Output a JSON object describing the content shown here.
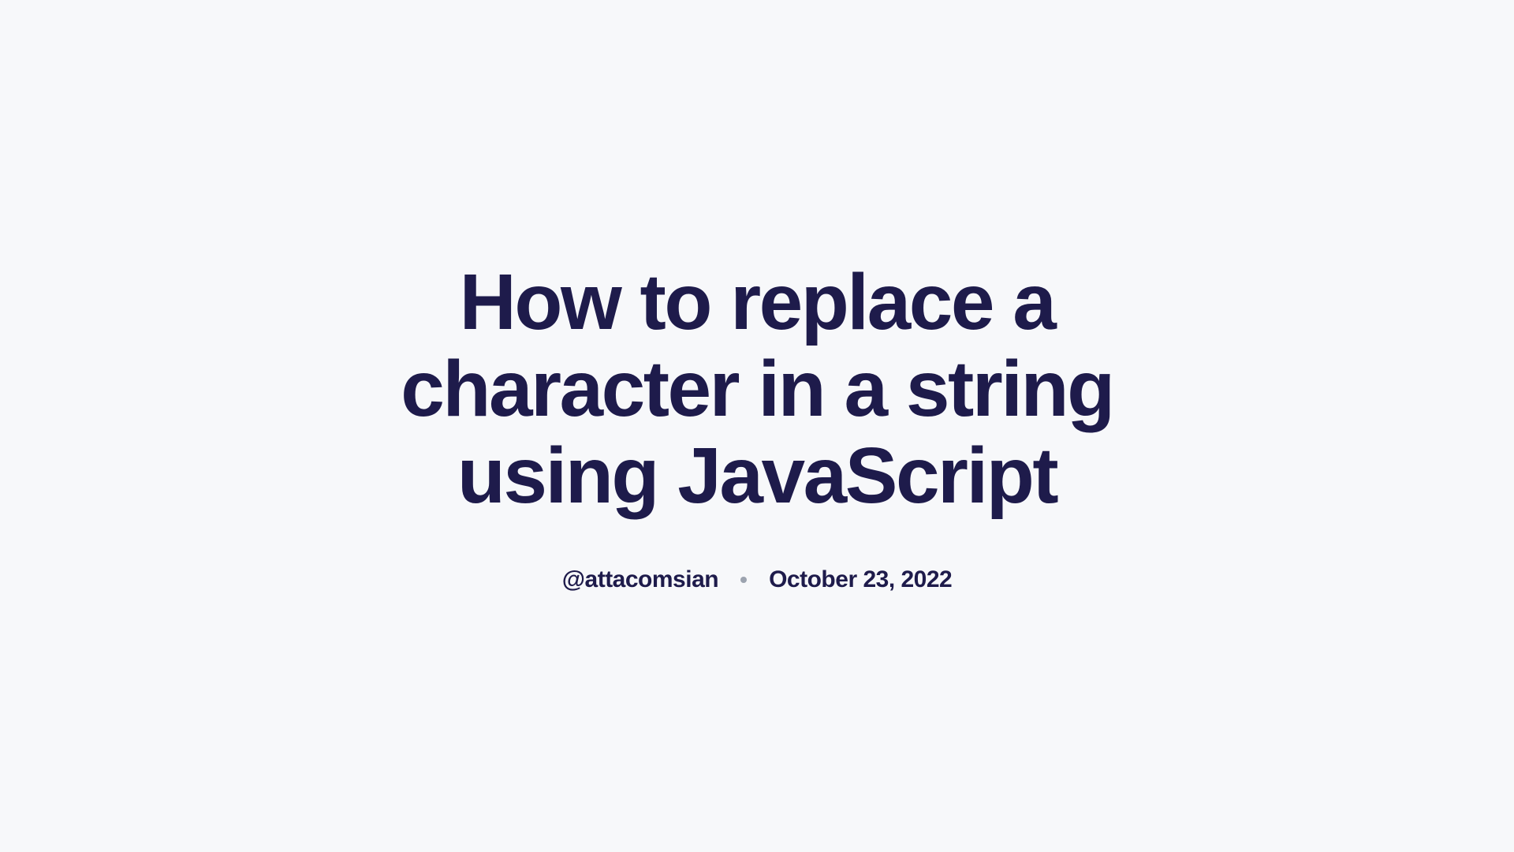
{
  "article": {
    "title": "How to replace a character in a string using JavaScript",
    "author": "@attacomsian",
    "date": "October 23, 2022"
  }
}
